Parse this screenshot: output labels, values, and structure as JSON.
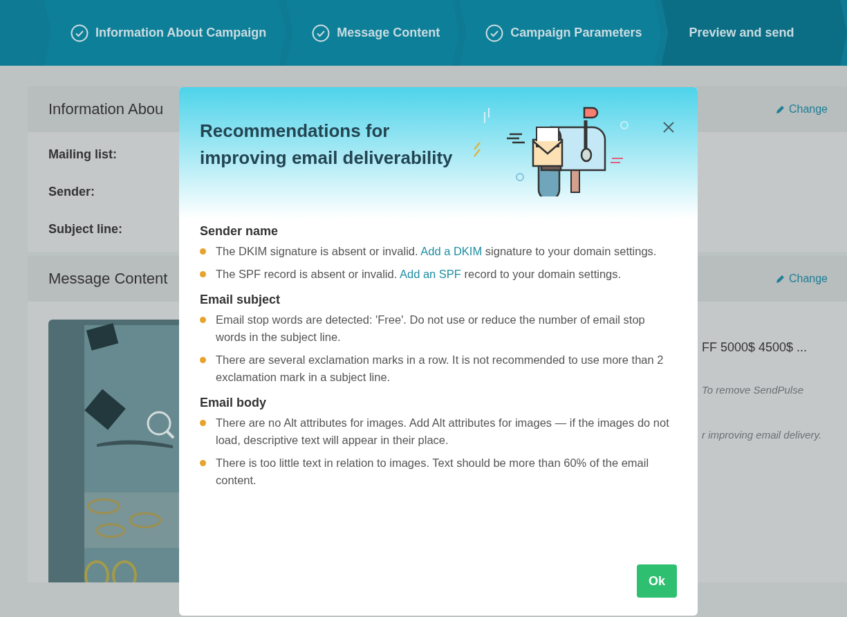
{
  "steps": [
    {
      "label": "Information About Campaign",
      "done": true,
      "selected": false
    },
    {
      "label": "Message Content",
      "done": true,
      "selected": false
    },
    {
      "label": "Campaign Parameters",
      "done": true,
      "selected": false
    },
    {
      "label": "Preview and send",
      "done": false,
      "selected": true
    }
  ],
  "cards": [
    {
      "title": "Information Abou",
      "action": "Change",
      "fields": [
        "Mailing list:",
        "Sender:",
        "Subject line:"
      ]
    },
    {
      "title": "Message Content",
      "action": "Change",
      "preview": {
        "kind": "picture"
      },
      "side_texts": [
        {
          "text": "FF 5000$ 4500$ ...",
          "kind": "subject"
        },
        {
          "text": "To remove SendPulse",
          "kind": "note"
        },
        {
          "text": "r improving email delivery.",
          "kind": "note"
        }
      ]
    }
  ],
  "modal": {
    "title": "Recommendations for improving email deliverability",
    "sections": [
      {
        "heading": "Sender name",
        "items": [
          {
            "before": "The DKIM signature is absent or invalid. ",
            "link": "Add a DKIM",
            "after": " signature to your domain settings."
          },
          {
            "before": "The SPF record is absent or invalid. ",
            "link": "Add an SPF",
            "after": " record to your domain settings."
          }
        ]
      },
      {
        "heading": "Email subject",
        "items": [
          {
            "before": "Email stop words are detected: 'Free'. Do not use or reduce the number of email stop words in the subject line."
          },
          {
            "before": "There are several exclamation marks in a row. It is not recommended to use more than 2 exclamation mark in a subject line."
          }
        ]
      },
      {
        "heading": "Email body",
        "items": [
          {
            "before": "There are no Alt attributes for images. Add Alt attributes for images — if the images do not load, descriptive text will appear in their place."
          },
          {
            "before": "There is too little text in relation to images. Text should be more than 60% of the email content."
          }
        ]
      }
    ],
    "ok": "Ok"
  }
}
